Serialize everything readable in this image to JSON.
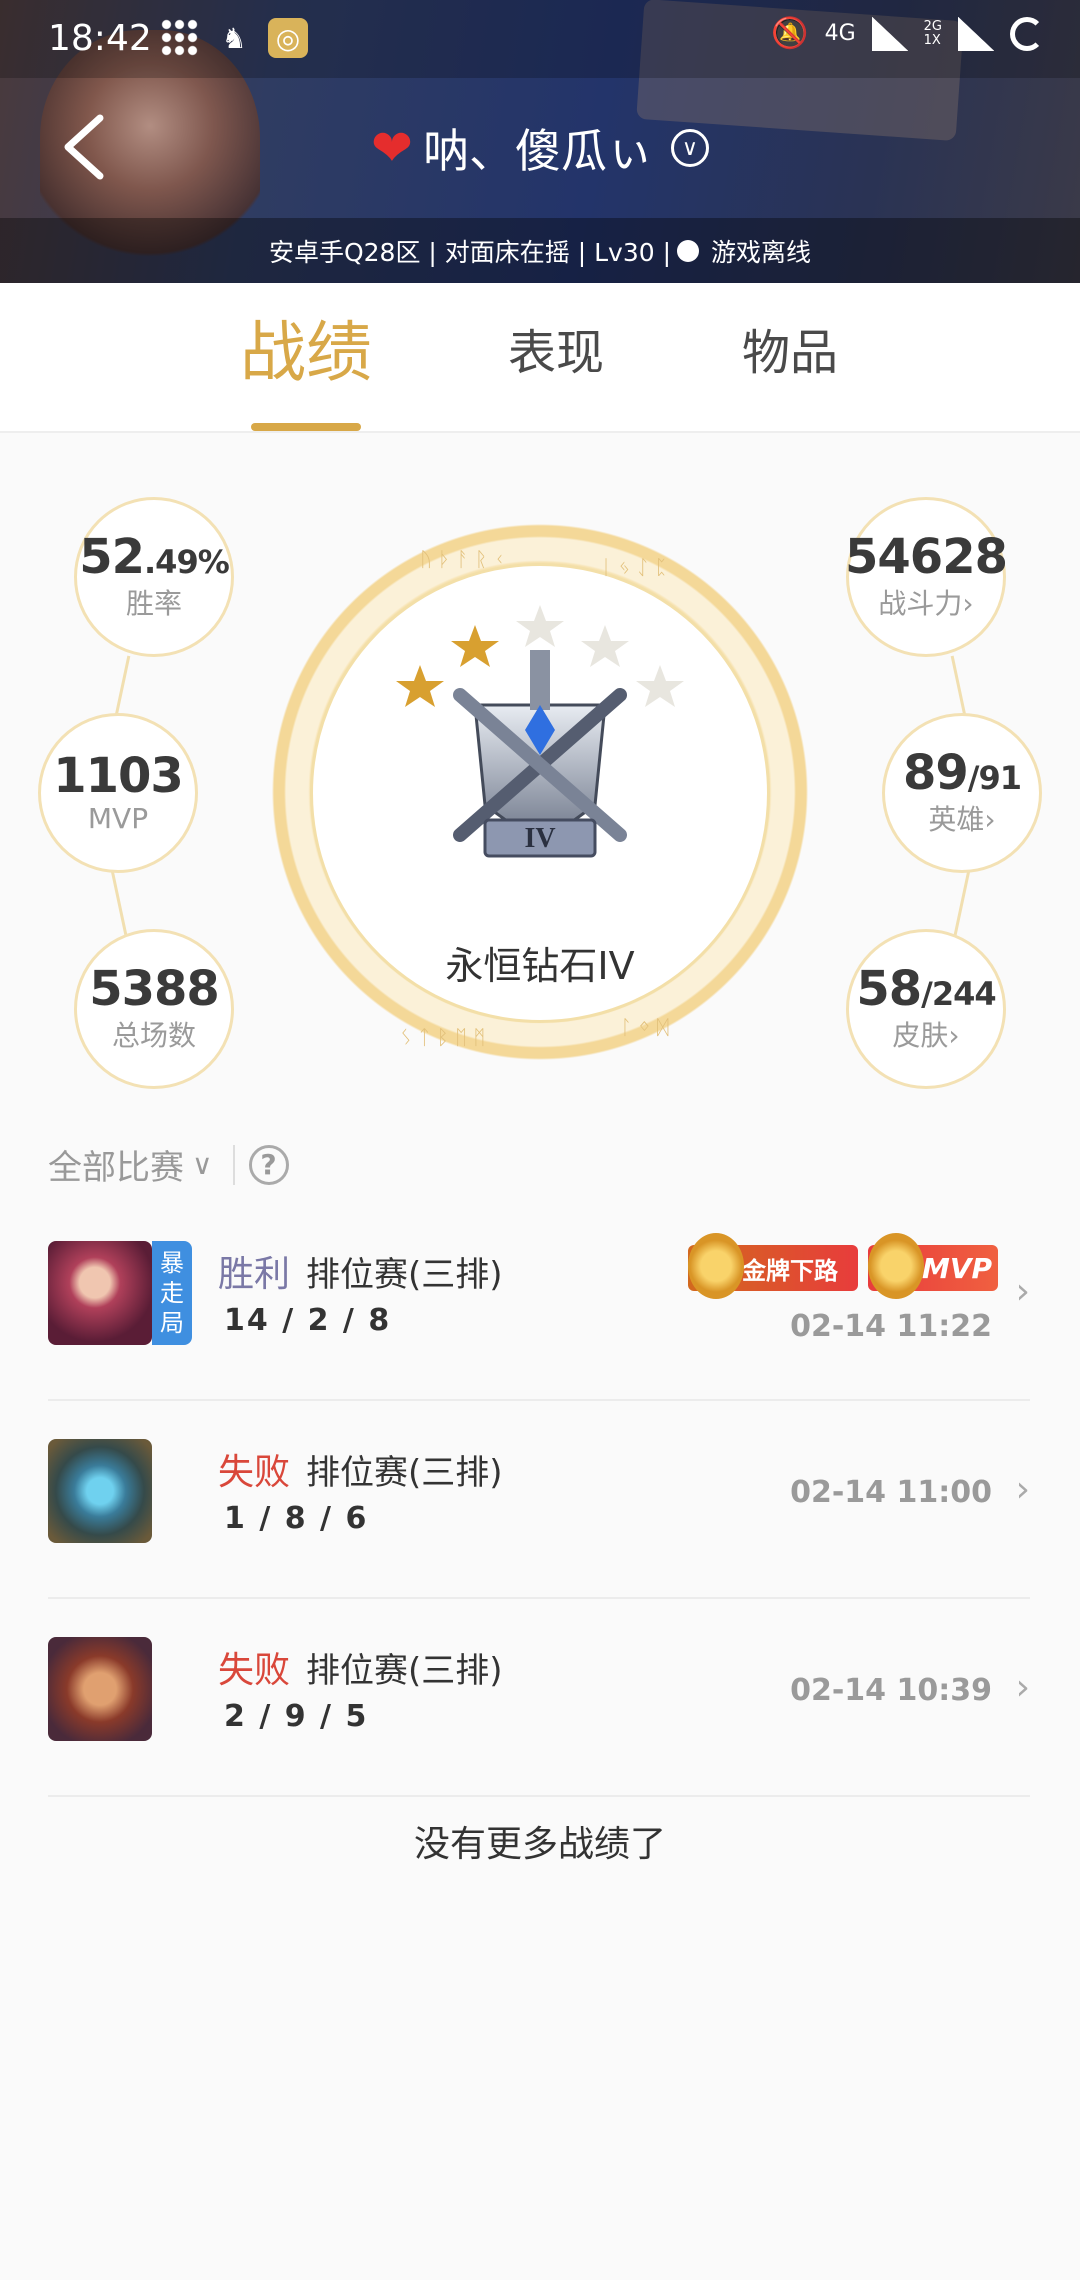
{
  "status_bar": {
    "time": "18:42",
    "net_4g": "4G",
    "net_2g": "2G",
    "net_1x": "1X"
  },
  "header": {
    "title": "呐、傻瓜ぃ",
    "info": "安卓手Q28区 | 对面床在摇 | Lv30 |",
    "status": "游戏离线",
    "colors": {
      "heart": "#e52d2d"
    }
  },
  "tabs": [
    {
      "label": "战绩",
      "active": true
    },
    {
      "label": "表现",
      "active": false
    },
    {
      "label": "物品",
      "active": false
    }
  ],
  "stats": {
    "win_rate_main": "52",
    "win_rate_dec": ".49%",
    "win_rate_label": "胜率",
    "mvp_value": "1103",
    "mvp_label": "MVP",
    "total_value": "5388",
    "total_label": "总场数",
    "power_value": "54628",
    "power_label": "战斗力",
    "heroes_value": "89",
    "heroes_total": "/91",
    "heroes_label": "英雄",
    "skins_value": "58",
    "skins_total": "/244",
    "skins_label": "皮肤",
    "rank_name": "永恒钻石IV",
    "rank_roman": "IV",
    "stars_filled": 2,
    "stars_total": 5
  },
  "filter": {
    "label": "全部比赛",
    "help": "?"
  },
  "matches": [
    {
      "result": "胜利",
      "mode": "排位赛(三排)",
      "kda": "14 / 2 / 8",
      "time": "02-14 11:22",
      "tag": [
        "暴",
        "走",
        "局"
      ],
      "badges": [
        "金牌下路",
        "MVP"
      ]
    },
    {
      "result": "失败",
      "mode": "排位赛(三排)",
      "kda": "1 / 8 / 6",
      "time": "02-14 11:00"
    },
    {
      "result": "失败",
      "mode": "排位赛(三排)",
      "kda": "2 / 9 / 5",
      "time": "02-14 10:39"
    }
  ],
  "no_more": "没有更多战绩了",
  "colors": {
    "accent": "#d8a848",
    "win": "#7a78a6",
    "lose": "#d9473a",
    "tag": "#3f8fe0"
  }
}
